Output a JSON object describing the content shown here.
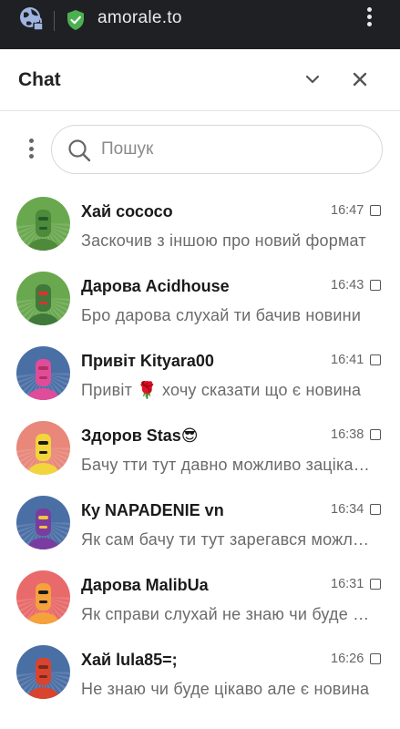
{
  "browser": {
    "url": "amorale.to",
    "icons": [
      "globe-lock-icon",
      "shield-check-icon",
      "more-vert-icon"
    ]
  },
  "header": {
    "title": "Chat",
    "icons": [
      "chevron-down-icon",
      "close-icon"
    ]
  },
  "search": {
    "placeholder": "Пошук",
    "value": ""
  },
  "chats": [
    {
      "name": "Хай сососо",
      "time": "16:47",
      "preview": "Заскочив з іншою про новий формат",
      "avatar_bg": "#6aa84f",
      "avatar_body": "#4f8a3a",
      "avatar_accent": "#1e5c2a"
    },
    {
      "name": "Дарова Acidhouse",
      "time": "16:43",
      "preview": "Бро дарова слухай ти бачив новини",
      "avatar_bg": "#6aa84f",
      "avatar_body": "#3f7a3b",
      "avatar_accent": "#e03030"
    },
    {
      "name": "Привіт Kityara00",
      "time": "16:41",
      "preview": "Привіт 🌹 хочу сказати що є новина",
      "avatar_bg": "#4a6fa5",
      "avatar_body": "#e04c9a",
      "avatar_accent": "#b03060"
    },
    {
      "name": "Здоров Stas😎",
      "time": "16:38",
      "preview": "Бачу тти тут давно можливо зацікавить",
      "avatar_bg": "#e8877a",
      "avatar_body": "#f2d43c",
      "avatar_accent": "#1a1a1a"
    },
    {
      "name": "Ку NAPADENIE vn",
      "time": "16:34",
      "preview": "Як сам бачу ти тут зарегався можливо",
      "avatar_bg": "#4a6fa5",
      "avatar_body": "#7a3ca0",
      "avatar_accent": "#f2c43c"
    },
    {
      "name": "Дарова MalibUa",
      "time": "16:31",
      "preview": "Як справи слухай не знаю чи буде цікаво",
      "avatar_bg": "#e86a6a",
      "avatar_body": "#f5a13c",
      "avatar_accent": "#1a1a1a"
    },
    {
      "name": "Хай lula85=;",
      "time": "16:26",
      "preview": "Не знаю чи буде цікаво але є новина",
      "avatar_bg": "#4a6fa5",
      "avatar_body": "#d9442e",
      "avatar_accent": "#7a2a1c"
    }
  ]
}
